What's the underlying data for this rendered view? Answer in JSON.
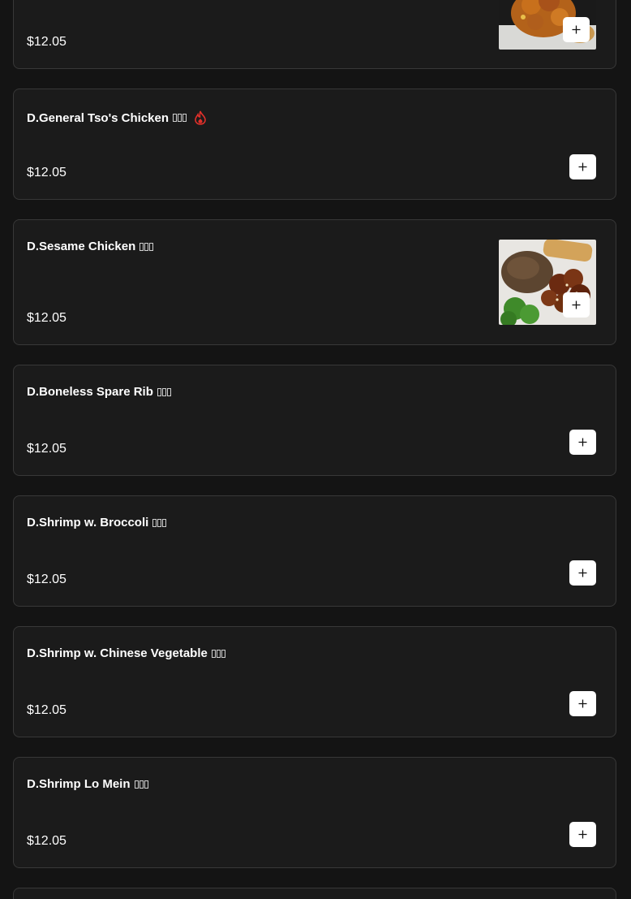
{
  "menu_items": [
    {
      "name": "",
      "price": "$12.05",
      "has_image": true,
      "image_desc": "general-tso-chicken-photo"
    },
    {
      "name": "D.General Tso's Chicken",
      "cjk_chars": 3,
      "spicy": true,
      "price": "$12.05",
      "has_image": false
    },
    {
      "name": "D.Sesame Chicken",
      "cjk_chars": 3,
      "price": "$12.05",
      "has_image": true,
      "image_desc": "sesame-chicken-photo"
    },
    {
      "name": "D.Boneless Spare Rib",
      "cjk_chars": 3,
      "price": "$12.05",
      "has_image": false
    },
    {
      "name": "D.Shrimp w. Broccoli",
      "cjk_chars": 3,
      "price": "$12.05",
      "has_image": false
    },
    {
      "name": "D.Shrimp w. Chinese Vegetable",
      "cjk_chars": 3,
      "price": "$12.05",
      "has_image": false
    },
    {
      "name": "D.Shrimp Lo Mein",
      "cjk_chars": 3,
      "price": "$12.05",
      "has_image": false
    }
  ],
  "icons": {
    "add": "plus-icon",
    "spicy": "flame-icon"
  },
  "colors": {
    "background": "#141414",
    "card": "#1b1b1b",
    "card_border": "#383838",
    "spicy": "#e0302a",
    "button": "#ffffff"
  }
}
